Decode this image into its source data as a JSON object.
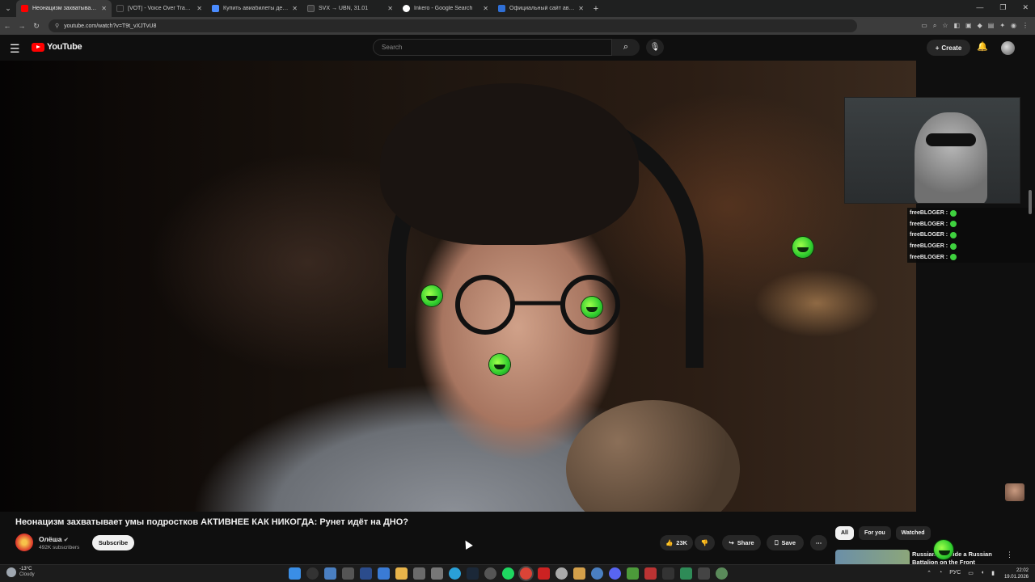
{
  "browser": {
    "tabs": [
      {
        "title": "Неонацизм захватывает у...",
        "color": "#ff0000",
        "active": true
      },
      {
        "title": "[VOT] - Voice Over Translation",
        "color": "#222222",
        "active": false
      },
      {
        "title": "Купить авиабилеты дешево о...",
        "color": "#4a8cff",
        "active": false
      },
      {
        "title": "SVX → UBN, 31.01",
        "color": "#3a3a3a",
        "active": false
      },
      {
        "title": "Inkero - Google Search",
        "color": "#ffffff",
        "active": false
      },
      {
        "title": "Официальный сайт авиакомп...",
        "color": "#2f6fd6",
        "active": false
      }
    ],
    "url": "youtube.com/watch?v=T9t_vXJTvU8"
  },
  "youtube": {
    "logo_text": "YouTube",
    "search_placeholder": "Search",
    "create_label": "Create"
  },
  "video": {
    "title": "Неонацизм захватывает умы подростков АКТИВНЕЕ КАК НИКОГДА: Рунет идёт на ДНО?",
    "channel_name": "Олёша",
    "subscribers": "492K subscribers",
    "subscribe_label": "Subscribe",
    "likes": "23K",
    "share_label": "Share",
    "save_label": "Save"
  },
  "overlay_chat": [
    {
      "user": "freeBLOGER :"
    },
    {
      "user": "freeBLOGER :"
    },
    {
      "user": "freeBLOGER :"
    },
    {
      "user": "freeBLOGER :"
    },
    {
      "user": "freeBLOGER :"
    }
  ],
  "chips": [
    "All",
    "For you",
    "Watched"
  ],
  "recommendation": {
    "title": "Russian ... Inside a Russian Battalion on the Front"
  },
  "taskbar": {
    "temperature": "-13°C",
    "condition": "Cloudy",
    "lang": "РУС",
    "time": "22:02",
    "date": "19.01.2026"
  },
  "colors": {
    "youtube_red": "#ff0000",
    "emote_green": "#3fd13f"
  }
}
